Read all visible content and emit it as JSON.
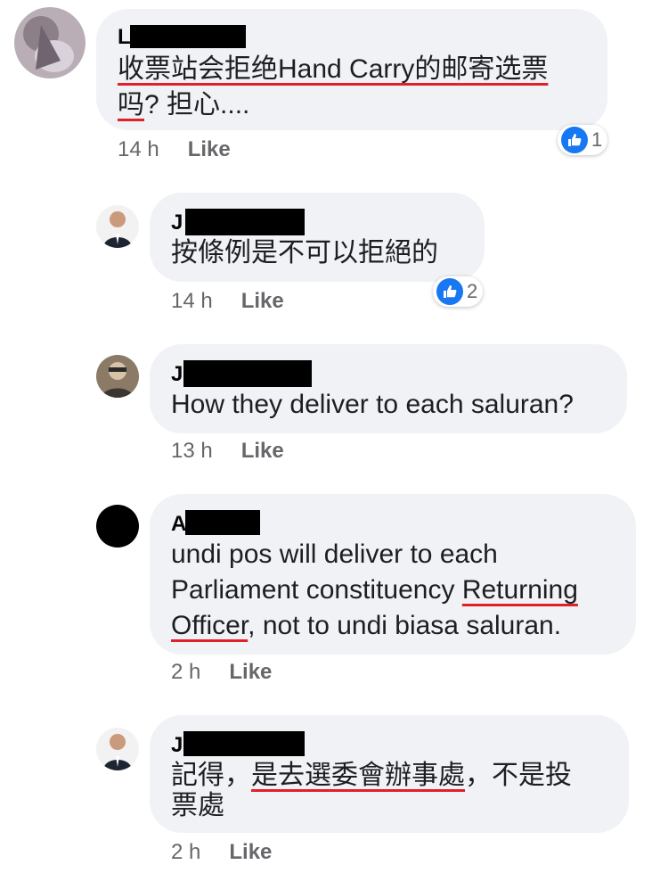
{
  "comments": [
    {
      "name": "L",
      "lines": [
        [
          "收票站会拒绝Hand Carry的邮寄选票",
          true
        ]
      ],
      "line2a": "吗",
      "line2b": "? 担心....",
      "time": "14 h",
      "like": "Like",
      "reaction_count": "1"
    },
    {
      "name": "J",
      "text": "按條例是不可以拒絕的",
      "time": "14 h",
      "like": "Like",
      "reaction_count": "2"
    },
    {
      "name": "J",
      "text": "How they deliver to each saluran?",
      "time": "13 h",
      "like": "Like"
    },
    {
      "name": "A",
      "line1": "undi pos will deliver to each",
      "line2a": "Parliament constituency ",
      "line2b": "Returning",
      "line3a": "Officer",
      "line3b": ", not to undi biasa saluran.",
      "time": "2 h",
      "like": "Like"
    },
    {
      "name": "J",
      "line1a": "記得，",
      "line1b": "是去選委會辦事處",
      "line1c": "，不是投",
      "line2": "票處",
      "time": "2 h",
      "like": "Like"
    }
  ],
  "icons": {
    "reaction": "like-thumb-icon"
  },
  "colors": {
    "bubble": "#f0f2f5",
    "underline": "#e0202a",
    "reaction": "#1877f2"
  }
}
